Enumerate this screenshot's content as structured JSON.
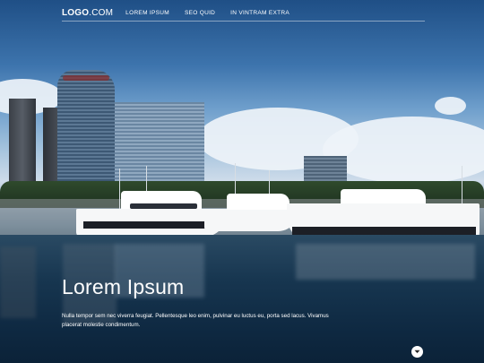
{
  "header": {
    "logo_main": "LOGO",
    "logo_suffix": ".COM",
    "nav_items": [
      "LOREM IPSUM",
      "SEO QUID",
      "IN VINTRAM EXTRA"
    ]
  },
  "hero": {
    "title": "Lorem Ipsum",
    "text": "Nulla tempor sem nec viverra feugiat. Pellentesque leo enim, pulvinar eu luctus eu, porta sed lacus. Vivamus placerat molestie condimentum."
  },
  "icons": {
    "scroll": "chevron-down-icon"
  }
}
